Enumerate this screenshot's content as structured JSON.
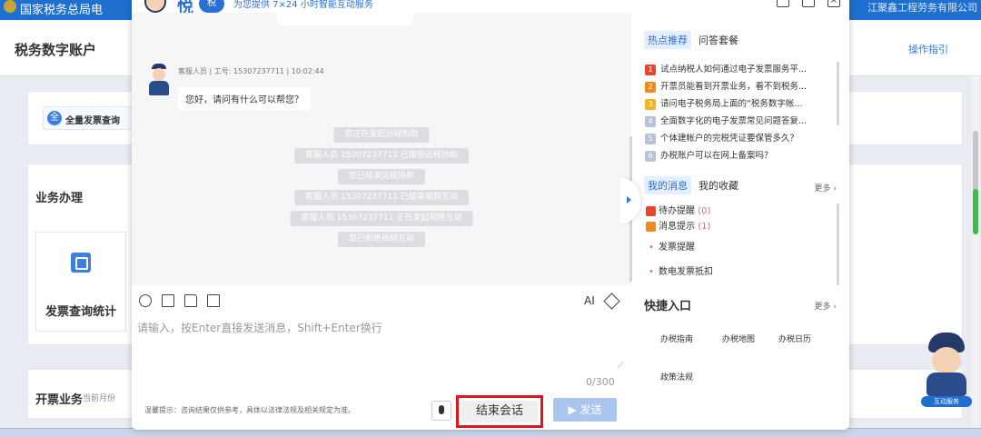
{
  "page": {
    "site_title": "国家税务总局电",
    "company": "江聚鑫工程劳务有限公司",
    "account_title": "税务数字账户",
    "guide_link": "操作指引",
    "card1_pill": "全量发票查询",
    "card1_pill_icon": "全",
    "section_business": "业务办理",
    "invoice_stats": "发票查询统计",
    "section_invoicing": "开票业务",
    "invoicing_sub": "当前月份",
    "mascot_tag": "互动服务"
  },
  "dialog": {
    "brand": "悦",
    "brand_badge": "税",
    "slogan": "为您提供 7×24 小时智能互动服务",
    "agent_meta": "客服人员 | 工号: 15307237711 | 10:02:44",
    "agent_message": "您好，请问有什么可以帮您？",
    "system_messages": [
      "您正在发起远程协助",
      "客服人员 15307237711 已接受远程协助",
      "您已结束远程协助",
      "客服人员 15307237711 已结束视频互动",
      "客服人员 15307237711 正在发起视频互动",
      "您已拒绝视频互动"
    ],
    "ai_label": "AI",
    "input_placeholder": "请输入，按Enter直接发送消息，Shift+Enter换行",
    "counter": "0/300",
    "disclaimer": "温馨提示：咨询结果仅供参考，具体以法律法规及相关规定为准。",
    "end_button": "结束会话",
    "send_button": "▶ 发送"
  },
  "right_panel": {
    "tabs": [
      "热点推荐",
      "问答套餐"
    ],
    "hot_items": [
      {
        "rank": "1",
        "text": "试点纳税人如何通过电子发票服务平...",
        "color": "#e8452f"
      },
      {
        "rank": "2",
        "text": "开票员能看到开票业务，看不到税务...",
        "color": "#f08a1c"
      },
      {
        "rank": "3",
        "text": "请问电子税务局上面的“税务数字帐...",
        "color": "#f4b320"
      },
      {
        "rank": "4",
        "text": "全面数字化的电子发票常见问题答复...",
        "color": "#b8c2d8"
      },
      {
        "rank": "5",
        "text": "个体建帐户的完税凭证要保管多久？",
        "color": "#b8c2d8"
      },
      {
        "rank": "6",
        "text": "办税账户可以在网上备案吗？",
        "color": "#b8c2d8"
      }
    ],
    "msg_tabs": [
      "我的消息",
      "我的收藏"
    ],
    "more_label": "更多 ›",
    "messages": [
      {
        "label": "待办提醒",
        "count": "(0)",
        "icon_color": "#e8452f"
      },
      {
        "label": "消息提示",
        "count": "(1)",
        "icon_color": "#f08a1c"
      }
    ],
    "sub_messages": [
      "发票提醒",
      "数电发票抵扣"
    ],
    "quick_title": "快捷入口",
    "quick_more": "更多 ›",
    "quick_items": [
      "办税指南",
      "办税地图",
      "办税日历",
      "政策法规"
    ]
  }
}
